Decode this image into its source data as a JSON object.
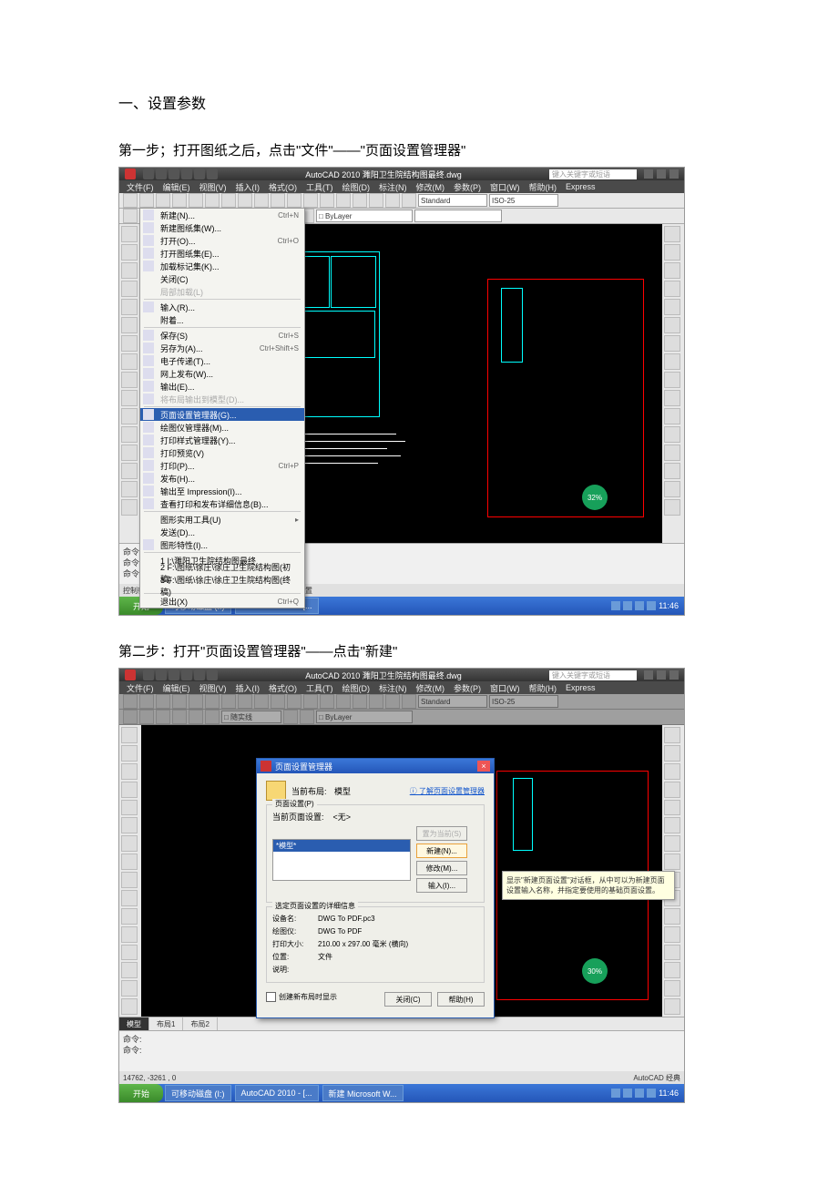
{
  "doc": {
    "heading": "一、设置参数",
    "step1": "第一步；打开图纸之后，点击\"文件\"——\"页面设置管理器\"",
    "step2": "第二步：打开\"页面设置管理器\"——点击\"新建\""
  },
  "app": {
    "title": "AutoCAD 2010  濉阳卫生院结构图最终.dwg",
    "search_placeholder": "键入关键字或短语",
    "menu": [
      "文件(F)",
      "编辑(E)",
      "视图(V)",
      "插入(I)",
      "格式(O)",
      "工具(T)",
      "绘图(D)",
      "标注(N)",
      "修改(M)",
      "参数(P)",
      "窗口(W)",
      "帮助(H)",
      "Express"
    ],
    "toolbar": {
      "linetype": "□ 随实线",
      "layer": "□ ByLayer",
      "style": "Standard",
      "dimstyle": "ISO-25"
    },
    "statusbar_hint": "控制新布局的页面布局、打印设备、图纸尺寸以及其他设置",
    "percent1": "32%",
    "percent2": "30%",
    "tabs": [
      "模型",
      "布局1",
      "布局2"
    ],
    "taskbar": {
      "start": "开始",
      "task1": "可移动磁盘 (I:)",
      "task2": "AutoCAD 2010 - [...",
      "task3": "新建 Microsoft W...",
      "clock1": "11:46",
      "clock2": "11:46"
    },
    "cmd": {
      "l1": "命令:",
      "l2": "命令:",
      "l3": "命令:",
      "coord": "14762, -3261 , 0",
      "ws": "AutoCAD 经典"
    }
  },
  "filemenu": [
    {
      "label": "新建(N)...",
      "sc": "Ctrl+N",
      "icon": true
    },
    {
      "label": "新建图纸集(W)...",
      "icon": true
    },
    {
      "label": "打开(O)...",
      "sc": "Ctrl+O",
      "icon": true
    },
    {
      "label": "打开图纸集(E)...",
      "icon": true
    },
    {
      "label": "加载标记集(K)...",
      "icon": true
    },
    {
      "label": "关闭(C)"
    },
    {
      "label": "局部加载(L)",
      "disabled": true
    },
    {
      "sep": true
    },
    {
      "label": "输入(R)...",
      "icon": true
    },
    {
      "label": "附着..."
    },
    {
      "sep": true
    },
    {
      "label": "保存(S)",
      "sc": "Ctrl+S",
      "icon": true
    },
    {
      "label": "另存为(A)...",
      "sc": "Ctrl+Shift+S",
      "icon": true
    },
    {
      "label": "电子传递(T)...",
      "icon": true
    },
    {
      "label": "网上发布(W)...",
      "icon": true
    },
    {
      "label": "输出(E)...",
      "icon": true
    },
    {
      "label": "将布局输出到模型(D)...",
      "disabled": true,
      "icon": true
    },
    {
      "sep": true
    },
    {
      "label": "页面设置管理器(G)...",
      "sel": true,
      "icon": true
    },
    {
      "label": "绘图仪管理器(M)...",
      "icon": true
    },
    {
      "label": "打印样式管理器(Y)...",
      "icon": true
    },
    {
      "label": "打印预览(V)",
      "icon": true
    },
    {
      "label": "打印(P)...",
      "sc": "Ctrl+P",
      "icon": true
    },
    {
      "label": "发布(H)...",
      "icon": true
    },
    {
      "label": "输出至 Impression(I)...",
      "icon": true
    },
    {
      "label": "查看打印和发布详细信息(B)...",
      "icon": true
    },
    {
      "sep": true
    },
    {
      "label": "图形实用工具(U)",
      "arrow": true
    },
    {
      "label": "发送(D)..."
    },
    {
      "label": "图形特性(I)...",
      "icon": true
    },
    {
      "sep": true
    },
    {
      "label": "1 I:\\濉阳卫生院结构图最终"
    },
    {
      "label": "2 F:\\图纸\\徐庄\\徐庄卫生院结构图(初稿)"
    },
    {
      "label": "3 F:\\图纸\\徐庄\\徐庄卫生院结构图(终稿)"
    },
    {
      "sep": true
    },
    {
      "label": "退出(X)",
      "sc": "Ctrl+Q"
    }
  ],
  "dialog": {
    "title": "页面设置管理器",
    "current_layout_label": "当前布局:",
    "current_layout": "模型",
    "learn_link": "了解页面设置管理器",
    "group1": "页面设置(P)",
    "current_setup_label": "当前页面设置:",
    "current_setup": "<无>",
    "list_item": "*模型*",
    "btn_set_current": "置为当前(S)",
    "btn_new": "新建(N)...",
    "btn_modify": "修改(M)...",
    "btn_import": "输入(I)...",
    "group2": "选定页面设置的详细信息",
    "info": [
      {
        "k": "设备名:",
        "v": "DWG To PDF.pc3"
      },
      {
        "k": "绘图仪:",
        "v": "DWG To PDF"
      },
      {
        "k": "打印大小:",
        "v": "210.00 x 297.00 毫米 (横向)"
      },
      {
        "k": "位置:",
        "v": "文件"
      },
      {
        "k": "说明:",
        "v": ""
      }
    ],
    "checkbox": "创建新布局时显示",
    "btn_close": "关闭(C)",
    "btn_help": "帮助(H)",
    "tooltip": "显示\"新建页面设置\"对话框，从中可以为新建页面设置输入名称，并指定要使用的基础页面设置。"
  }
}
